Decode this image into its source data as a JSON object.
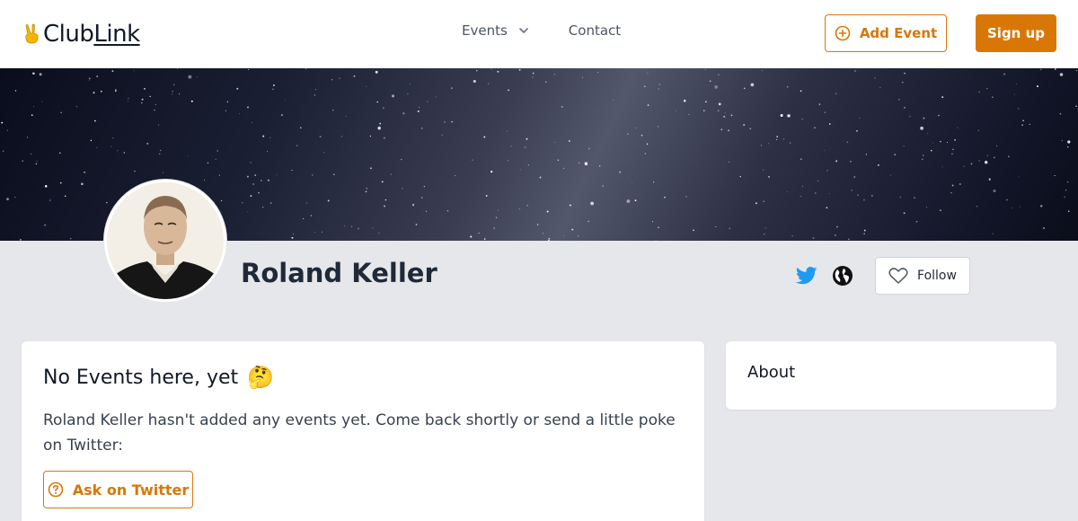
{
  "app": {
    "logo_prefix": "Club",
    "logo_underlined": "Link"
  },
  "nav": {
    "events_label": "Events",
    "contact_label": "Contact"
  },
  "header": {
    "add_event_label": "Add Event",
    "signup_label": "Sign up"
  },
  "profile": {
    "name": "Roland Keller",
    "follow_label": "Follow"
  },
  "events_card": {
    "title": "No Events here, yet",
    "emoji": "🤔",
    "message": "Roland Keller hasn't added any events yet. Come back shortly or send a little poke on Twitter:",
    "ask_button_label": "Ask on Twitter"
  },
  "about_card": {
    "title": "About"
  },
  "colors": {
    "accent": "#d97706",
    "twitter": "#1d9bf0",
    "background": "#e5e7eb"
  }
}
